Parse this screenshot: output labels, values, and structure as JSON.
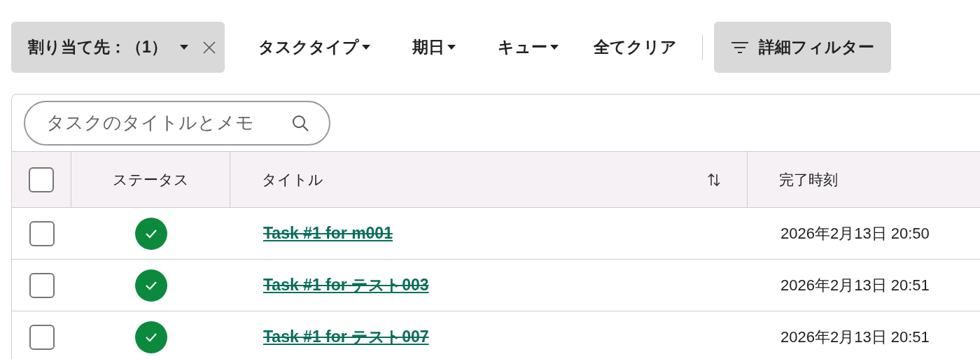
{
  "filters": [
    {
      "kind": "chip",
      "label": "割り当て先：（1）"
    },
    {
      "kind": "dropdown",
      "label": "タスクタイプ"
    },
    {
      "kind": "dropdown",
      "label": "期日"
    },
    {
      "kind": "dropdown",
      "label": "キュー"
    },
    {
      "kind": "text",
      "label": "全てクリア"
    }
  ],
  "advanced_filter": {
    "label": "詳細フィルター"
  },
  "search": {
    "placeholder": "タスクのタイトルとメモ"
  },
  "table": {
    "select_all": {
      "checked": false
    },
    "columns": [
      "ステータス",
      "タイトル",
      "完了時刻"
    ],
    "rows": [
      {
        "checked": false,
        "done": true,
        "title": "Task #1 for m001",
        "completed": "2026年2月13日 20:50"
      },
      {
        "checked": false,
        "done": true,
        "title": "Task #1 for テスト003",
        "completed": "2026年2月13日 20:51"
      },
      {
        "checked": false,
        "done": true,
        "title": "Task #1 for テスト007",
        "completed": "2026年2月13日 20:51"
      }
    ]
  }
}
